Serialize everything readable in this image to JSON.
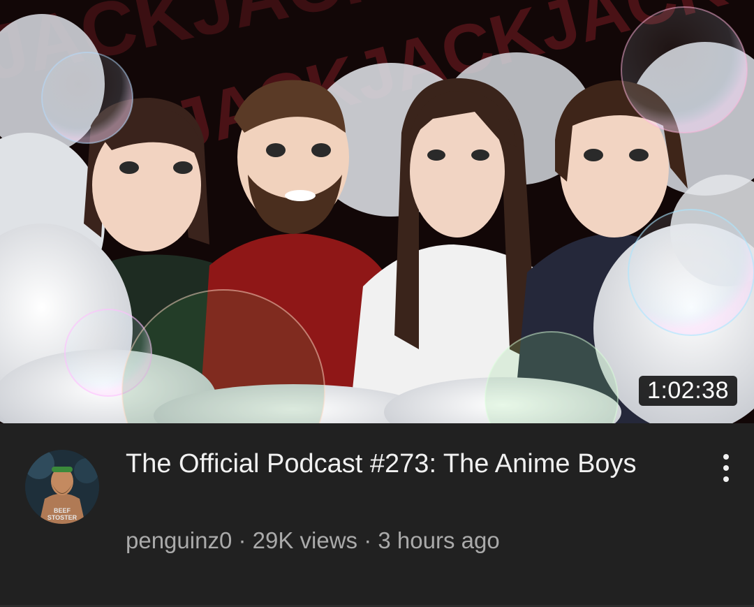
{
  "video": {
    "title": "The Official Podcast #273: The Anime Boys",
    "duration": "1:02:38",
    "channel": "penguinz0",
    "views": "29K views",
    "age": "3 hours ago",
    "separator": "·",
    "avatar_text_line1": "BEEF",
    "avatar_text_line2": "STOSTER",
    "thumbnail_background_text": "JACKJACKJACK"
  },
  "colors": {
    "background": "#212121",
    "title": "#f1f1f1",
    "subtitle": "#aaaaaa",
    "duration_badge": "#000000"
  },
  "icons": {
    "menu": "vertical-ellipsis-icon"
  }
}
